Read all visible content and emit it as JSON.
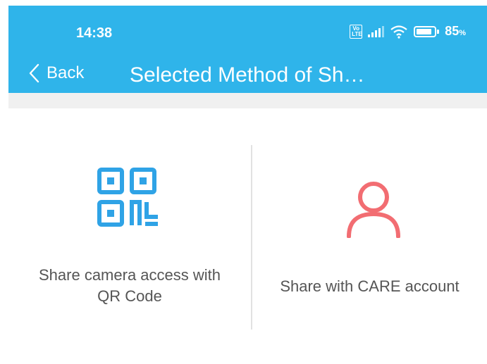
{
  "status_bar": {
    "time": "14:38",
    "volte": "Vo\nLTE",
    "battery_percent": "85",
    "battery_unit": "%",
    "battery_level": 0.85
  },
  "header": {
    "back_label": "Back",
    "title": "Selected Method of Sh…",
    "background_color": "#2fb4ea"
  },
  "options": [
    {
      "label": "Share camera access with QR Code",
      "icon": "qr-code-icon",
      "color": "#2fa3e6"
    },
    {
      "label": "Share with CARE account",
      "icon": "person-icon",
      "color": "#f26d72"
    }
  ]
}
